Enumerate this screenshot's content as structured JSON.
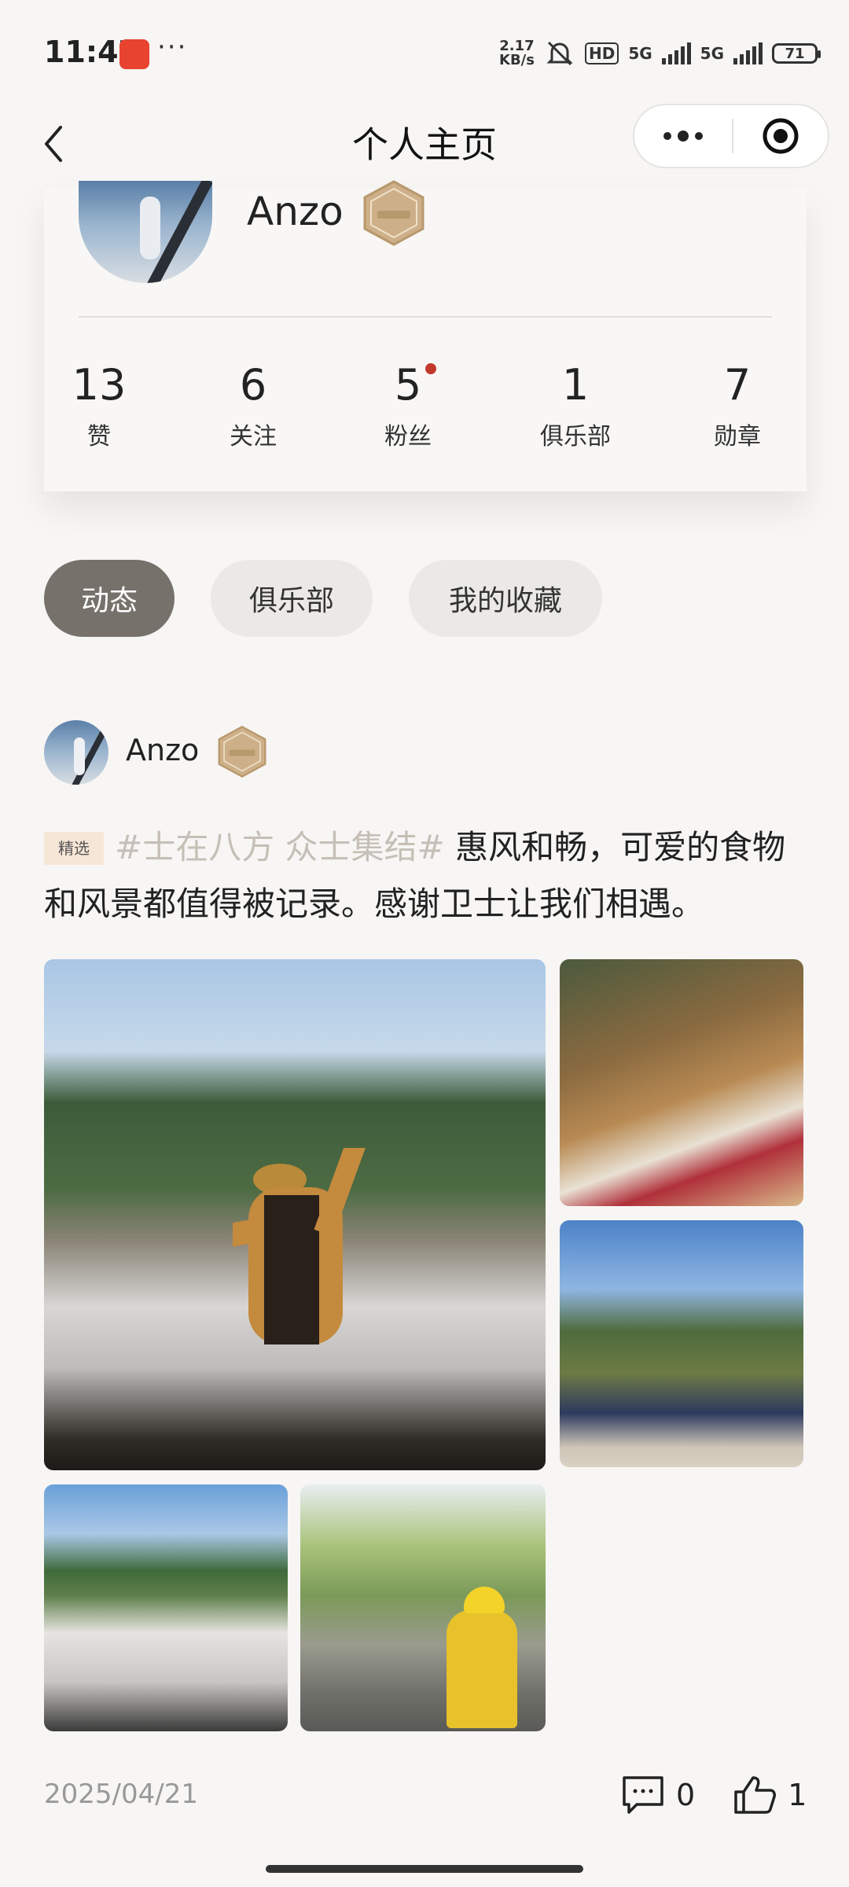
{
  "status_bar": {
    "time": "11:47",
    "network_speed": "2.17\nKB/s",
    "hd_label": "HD",
    "sim1_label": "5G",
    "sim2_label": "5G",
    "battery": "71",
    "more": "···"
  },
  "nav": {
    "title": "个人主页"
  },
  "profile": {
    "name": "Anzo",
    "stats": [
      {
        "value": "13",
        "label": "赞"
      },
      {
        "value": "6",
        "label": "关注"
      },
      {
        "value": "5",
        "label": "粉丝"
      },
      {
        "value": "1",
        "label": "俱乐部"
      },
      {
        "value": "7",
        "label": "勋章"
      }
    ]
  },
  "tabs": [
    {
      "label": "动态",
      "active": true
    },
    {
      "label": "俱乐部",
      "active": false
    },
    {
      "label": "我的收藏",
      "active": false
    }
  ],
  "post": {
    "author": "Anzo",
    "featured_tag": "精选",
    "hashtag": "#士在八方 众士集结#",
    "text": " 惠风和畅，可爱的食物和风景都值得被记录。感谢卫士让我们相遇。",
    "date": "2025/04/21",
    "comments": "0",
    "likes": "1"
  },
  "colors": {
    "active_tab_bg": "#76716b",
    "inactive_tab_bg": "#ebe9e6",
    "hashtag": "#c5bfb6",
    "featured_bg": "#f6e6d6",
    "notification_dot": "#c0392b",
    "page_bg": "#f7f6f4"
  }
}
